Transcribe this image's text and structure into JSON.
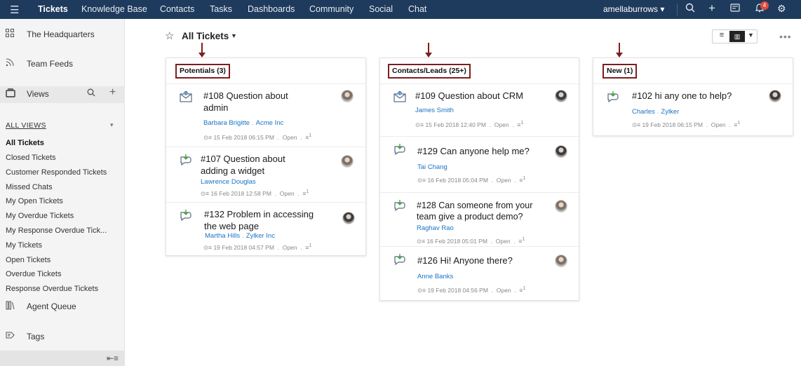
{
  "nav": {
    "items": [
      "Tickets",
      "Knowledge Base",
      "Contacts",
      "Tasks",
      "Dashboards",
      "Community",
      "Social",
      "Chat"
    ],
    "active": "Tickets",
    "user": "amellaburrows",
    "notification_count": "4"
  },
  "sidebar": {
    "headquarters": "The Headquarters",
    "team_feeds": "Team Feeds",
    "views": "Views",
    "all_views": "ALL VIEWS",
    "view_items": [
      "All Tickets",
      "Closed Tickets",
      "Customer Responded Tickets",
      "Missed Chats",
      "My Open Tickets",
      "My Overdue Tickets",
      "My Response Overdue Tick...",
      "My Tickets",
      "Open Tickets",
      "Overdue Tickets",
      "Response Overdue Tickets"
    ],
    "agent_queue": "Agent Queue",
    "tags": "Tags"
  },
  "main": {
    "view_title": "All Tickets",
    "more": "•••"
  },
  "columns": [
    {
      "label": "Potentials (3)",
      "cards": [
        {
          "title": "#108 Question about admin",
          "contact": "Barbara Brigitte",
          "account": "Acme Inc",
          "date": "15 Feb 2018 06:15 PM",
          "status": "Open",
          "channel": "email"
        },
        {
          "title": "#107 Question about adding a widget",
          "contact": "Lawrence Douglas",
          "account": "",
          "date": "16 Feb 2018 12:58 PM",
          "status": "Open",
          "channel": "chat"
        },
        {
          "title": "#132 Problem in accessing the web page",
          "contact": "Martha Hills",
          "account": "Zylker Inc",
          "date": "19 Feb 2018 04:57 PM",
          "status": "Open",
          "channel": "chat"
        }
      ]
    },
    {
      "label": "Contacts/Leads (25+)",
      "cards": [
        {
          "title": "#109 Question about CRM",
          "contact": "James Smith",
          "account": "",
          "date": "15 Feb 2018 12:40 PM",
          "status": "Open",
          "channel": "email"
        },
        {
          "title": "#129 Can anyone help me?",
          "contact": "Tai Chang",
          "account": "",
          "date": "16 Feb 2018 05:04 PM",
          "status": "Open",
          "channel": "chat"
        },
        {
          "title": "#128 Can someone from your team give a product demo?",
          "contact": "Raghav Rao",
          "account": "",
          "date": "16 Feb 2018 05:01 PM",
          "status": "Open",
          "channel": "chat"
        },
        {
          "title": "#126 Hi! Anyone there?",
          "contact": "Anne Banks",
          "account": "",
          "date": "19 Feb 2018 04:56 PM",
          "status": "Open",
          "channel": "chat"
        }
      ]
    },
    {
      "label": "New (1)",
      "cards": [
        {
          "title": "#102 hi any one to help?",
          "contact": "Charles",
          "account": "Zylker",
          "date": "19 Feb 2018 06:15 PM",
          "status": "Open",
          "channel": "chat"
        }
      ]
    }
  ],
  "colors": {
    "topbar": "#1e3a5c",
    "link": "#1a73c5",
    "annotation": "#7b1f1f",
    "badge": "#e24b3b"
  }
}
